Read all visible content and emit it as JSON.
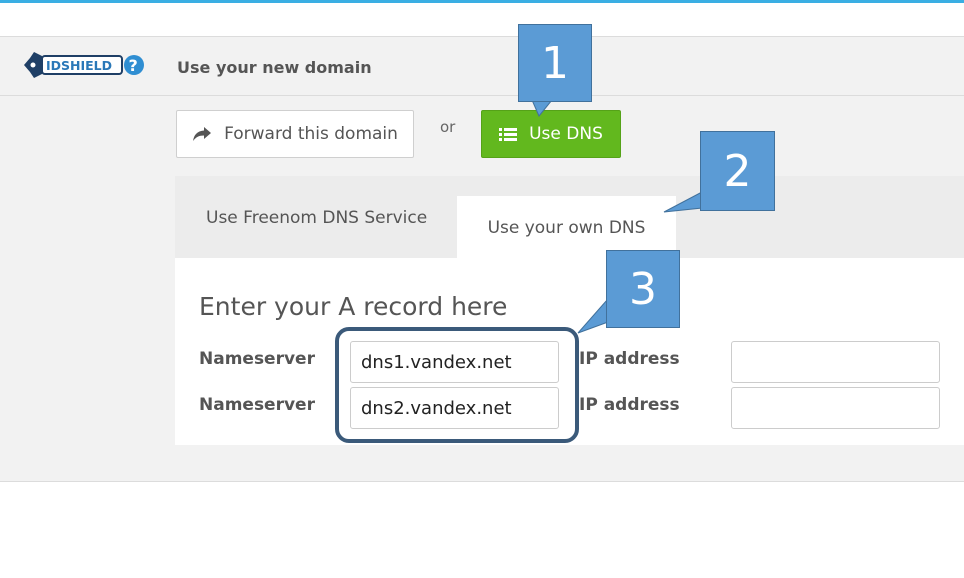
{
  "header": {
    "logo_text": "IDSHIELD",
    "title": "Use your new domain"
  },
  "actions": {
    "forward_label": "Forward this domain",
    "or_text": "or",
    "dns_label": "Use DNS"
  },
  "tabs": [
    {
      "label": "Use Freenom DNS Service",
      "active": false
    },
    {
      "label": "Use your own DNS",
      "active": true
    }
  ],
  "form": {
    "title": "Enter your A record here",
    "rows": [
      {
        "ns_label": "Nameserver",
        "ns_value": "dns1.vandex.net",
        "ip_label": "IP address",
        "ip_value": ""
      },
      {
        "ns_label": "Nameserver",
        "ns_value": "dns2.vandex.net",
        "ip_label": "IP address",
        "ip_value": ""
      }
    ]
  },
  "callouts": [
    "1",
    "2",
    "3"
  ],
  "colors": {
    "accent_line": "#3aaee3",
    "dns_button": "#62b81e",
    "callout_fill": "#5b9bd5",
    "highlight_border": "#3b5a7a"
  },
  "icons": {
    "forward": "share-arrow-icon",
    "dns": "list-icon"
  }
}
